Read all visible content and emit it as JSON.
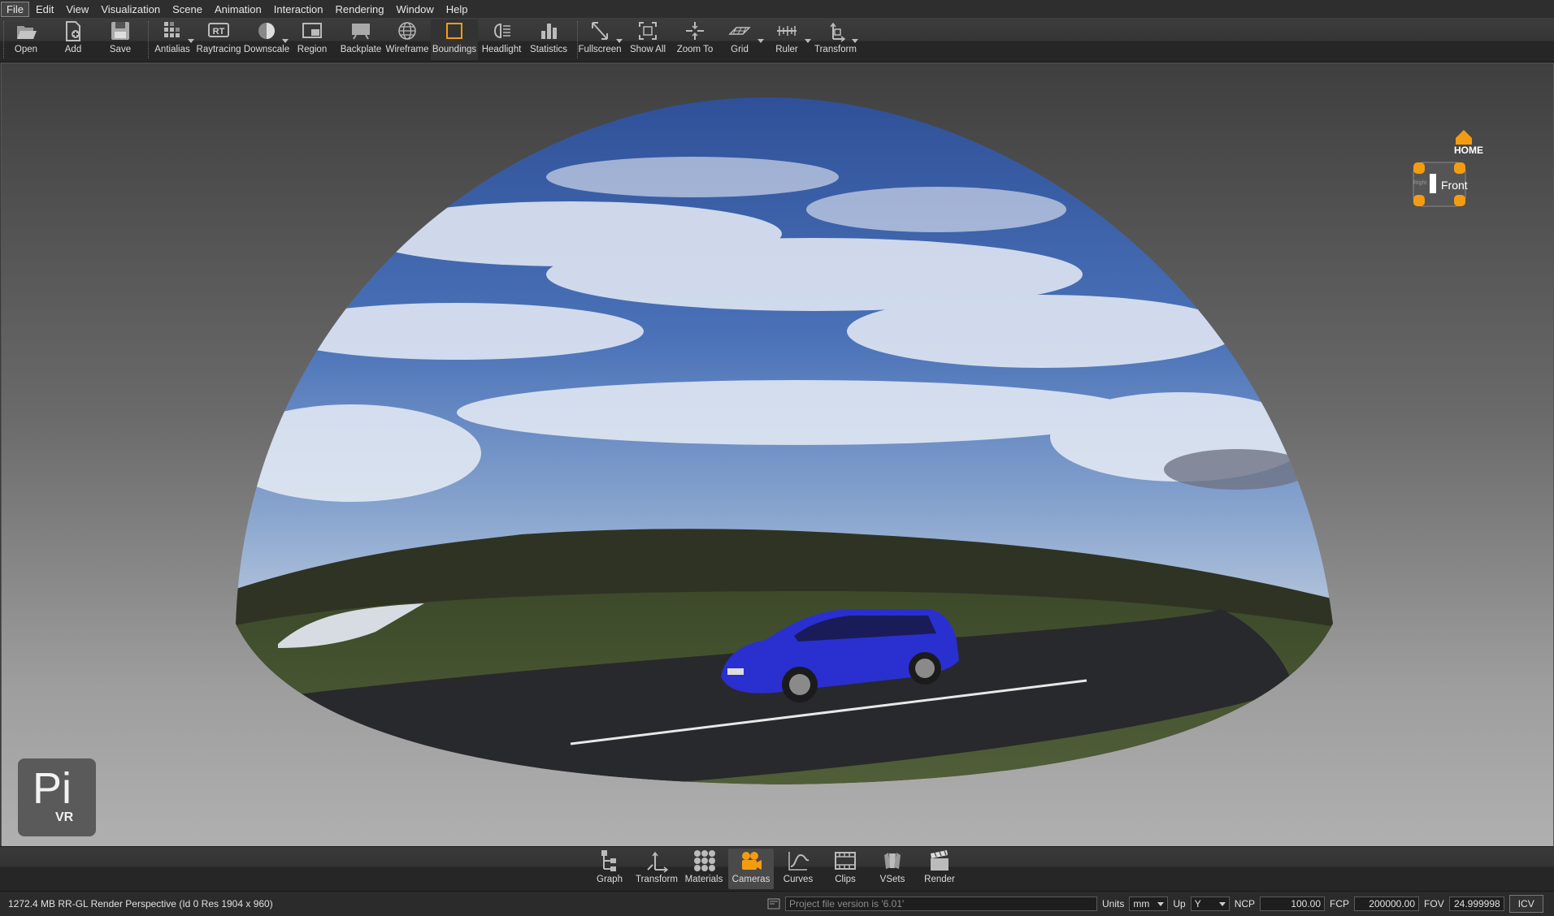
{
  "menu": [
    "File",
    "Edit",
    "View",
    "Visualization",
    "Scene",
    "Animation",
    "Interaction",
    "Rendering",
    "Window",
    "Help"
  ],
  "toolbar": {
    "open": "Open",
    "add": "Add",
    "save": "Save",
    "antialias": "Antialias",
    "raytracing": "Raytracing",
    "downscale": "Downscale",
    "region": "Region",
    "backplate": "Backplate",
    "wireframe": "Wireframe",
    "boundings": "Boundings",
    "headlight": "Headlight",
    "statistics": "Statistics",
    "fullscreen": "Fullscreen",
    "show_all": "Show All",
    "zoom_to": "Zoom To",
    "grid": "Grid",
    "ruler": "Ruler",
    "transform": "Transform",
    "rt_badge": "RT"
  },
  "navcube": {
    "home": "HOME",
    "front": "Front",
    "right": "Right"
  },
  "logo": {
    "pi": "Pi",
    "vr": "VR"
  },
  "dock": [
    "Graph",
    "Transform",
    "Materials",
    "Cameras",
    "Curves",
    "Clips",
    "VSets",
    "Render"
  ],
  "dock_active": "Cameras",
  "status": {
    "info": "1272.4 MB  RR-GL  Render Perspective (Id 0 Res 1904 x 960)",
    "message": "Project file version is '6.01'",
    "units_label": "Units",
    "units_value": "mm",
    "up_label": "Up",
    "up_value": "Y",
    "ncp_label": "NCP",
    "ncp_value": "100.00",
    "fcp_label": "FCP",
    "fcp_value": "200000.00",
    "fov_label": "FOV",
    "fov_value": "24.999998",
    "icv": "ICV"
  },
  "colors": {
    "accent": "#f39c12",
    "car": "#2a2fd0",
    "sky": "#4a72b8"
  }
}
